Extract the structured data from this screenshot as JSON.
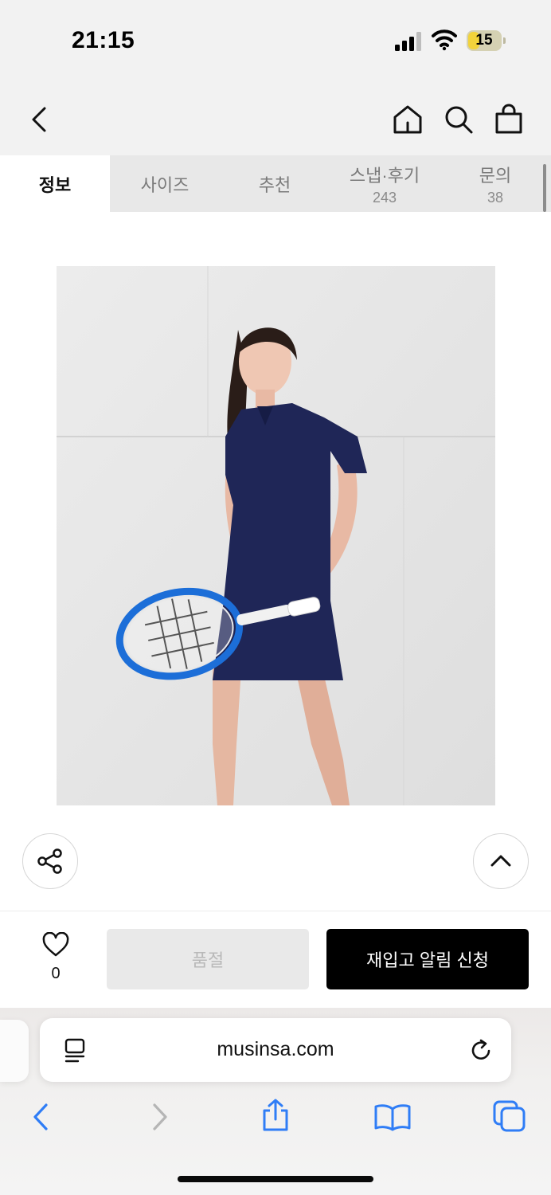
{
  "status_bar": {
    "time": "21:15",
    "battery": "15"
  },
  "header": {
    "icons": [
      "back-icon",
      "home-icon",
      "search-icon",
      "shopping-bag-icon"
    ]
  },
  "tabs": [
    {
      "label": "정보",
      "count": ""
    },
    {
      "label": "사이즈",
      "count": ""
    },
    {
      "label": "추천",
      "count": ""
    },
    {
      "label": "스냅·후기",
      "count": "243"
    },
    {
      "label": "문의",
      "count": "38"
    }
  ],
  "product": {
    "image_icon": "product-photo"
  },
  "floating": {
    "share_icon": "share-icon",
    "top_icon": "chevron-up-icon"
  },
  "buy_bar": {
    "like_count": "0",
    "soldout_label": "품절",
    "restock_label": "재입고 알림 신청"
  },
  "browser": {
    "url": "musinsa.com",
    "icons": [
      "reader-icon",
      "reload-icon",
      "back-arrow-icon",
      "forward-arrow-icon",
      "share-sheet-icon",
      "bookmarks-icon",
      "tabs-icon"
    ]
  },
  "colors": {
    "accent_blue": "#2f7df6",
    "button_black": "#000000",
    "soldout_gray": "#e9e9e9"
  }
}
